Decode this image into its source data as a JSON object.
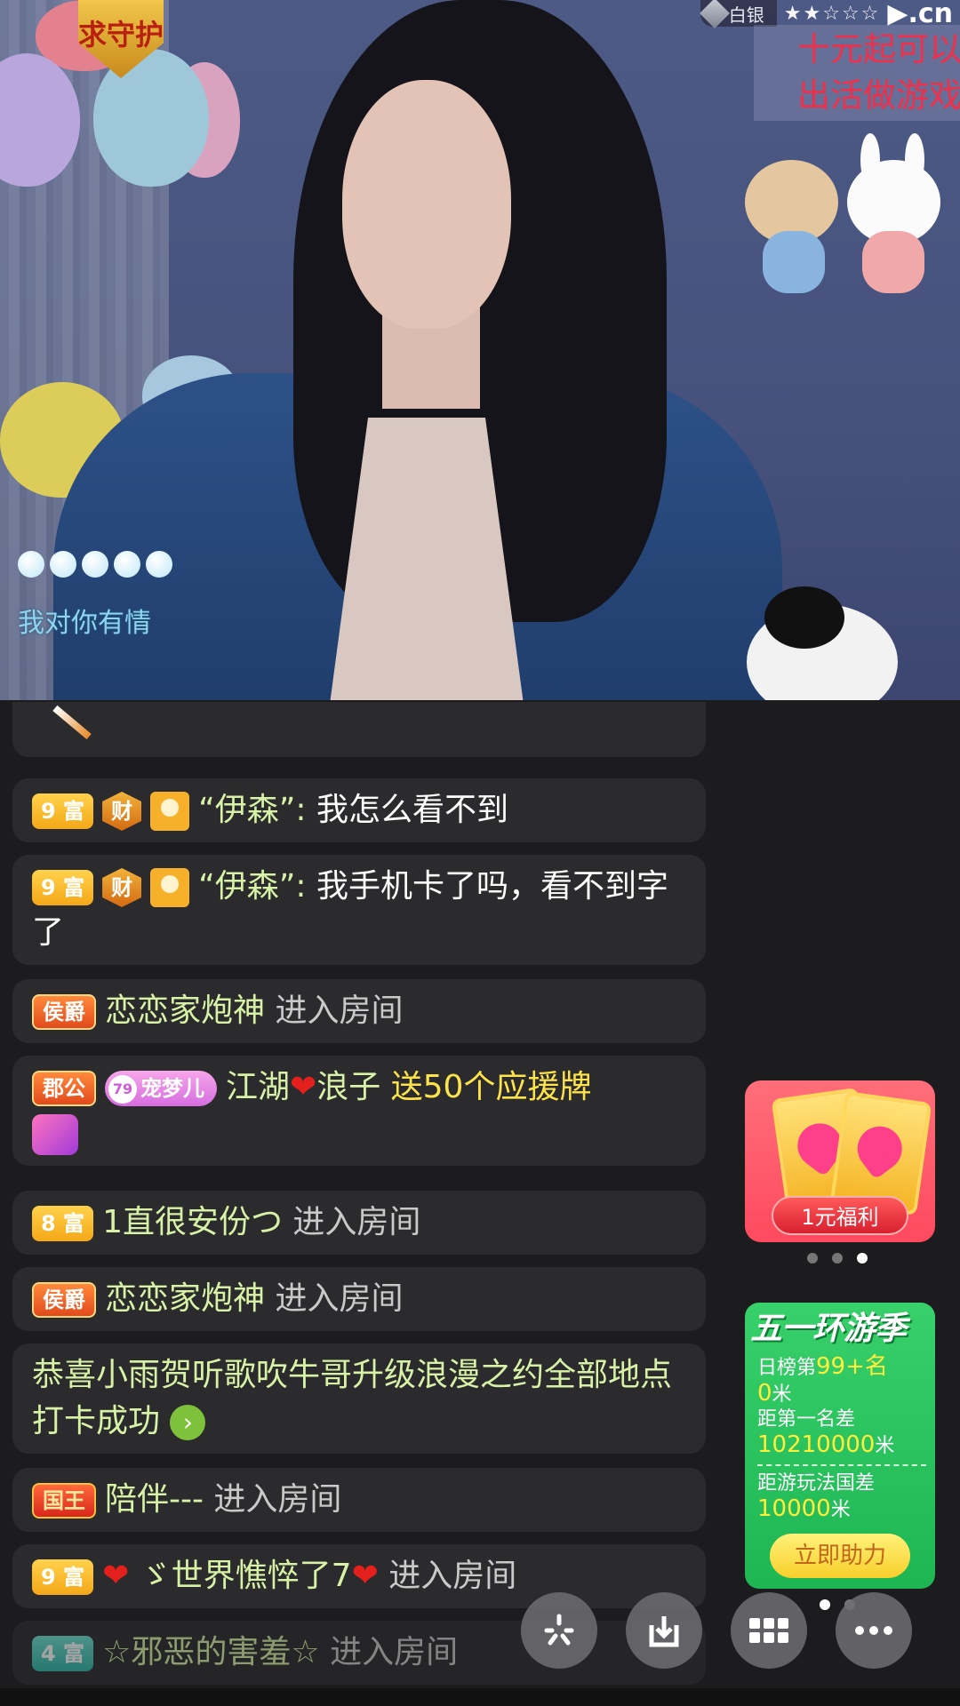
{
  "stream": {
    "shield_text": "求守护",
    "rank_label": "白银",
    "stars_icon": "☆",
    "brand_text": "▶.cn",
    "notice_lines": [
      "十元起可以",
      "出活做游戏"
    ],
    "overlay_text": "我对你有情"
  },
  "chat": {
    "messages": [
      {
        "type": "gift-fragment"
      },
      {
        "badges": [
          "9 富",
          "财"
        ],
        "user": "“伊森”: ",
        "text": "我怎么看不到"
      },
      {
        "badges": [
          "9 富",
          "财"
        ],
        "user": "“伊森”: ",
        "text": "我手机卡了吗，看不到字了"
      },
      {
        "badges": [
          "侯爵"
        ],
        "user": "恋恋家炮神",
        "action": " 进入房间"
      },
      {
        "badges": [
          "郡公",
          "79",
          "宠梦儿"
        ],
        "user_a": "江湖",
        "user_b": "浪子",
        "gift_text": " 送50个应援牌"
      },
      {
        "badges": [
          "8 富"
        ],
        "user": "1直很安份つ",
        "action": " 进入房间"
      },
      {
        "badges": [
          "侯爵"
        ],
        "user": "恋恋家炮神",
        "action": " 进入房间"
      },
      {
        "system": "恭喜小雨贺听歌吹牛哥升级浪漫之约全部地点打卡成功"
      },
      {
        "badges": [
          "国王"
        ],
        "user": "陪伴---",
        "action": " 进入房间"
      },
      {
        "badges": [
          "9 富"
        ],
        "user": "ゞ世界憔悴了7",
        "action": " 进入房间"
      },
      {
        "badges": [
          "4 富"
        ],
        "user": "☆邪恶的害羞☆",
        "action": " 进入房间"
      }
    ]
  },
  "promo": {
    "welfare_label": "1元福利",
    "season_title": "五一环游季",
    "daily_rank_prefix": "日榜第",
    "daily_rank_value": "99+名",
    "distance_value": "0",
    "meter_unit": "米",
    "gap_first_label": "距第一名差",
    "gap_first_value": "10210000",
    "gap_king_label": "距游玩法国差",
    "gap_king_value": "10000",
    "help_button": "立即助力"
  },
  "colors": {
    "chat_bg": "#2b2b2d",
    "username": "#d7f2a6",
    "gift": "#ffe34a",
    "notice_red": "#f0304a"
  },
  "icons": [
    "sparkle-icon",
    "download-icon",
    "grid-icon",
    "more-icon"
  ]
}
